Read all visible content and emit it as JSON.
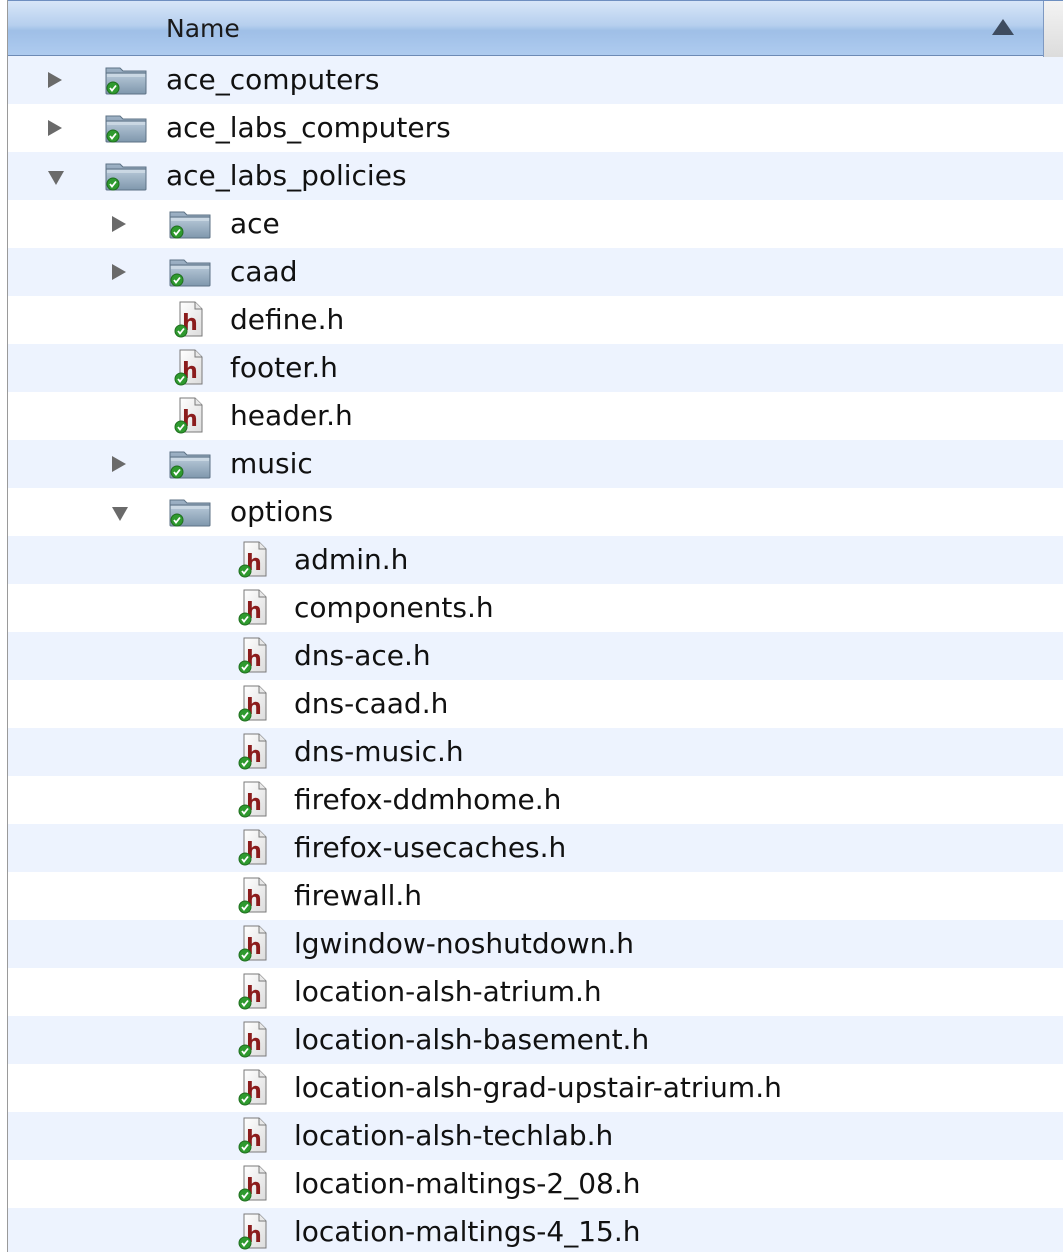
{
  "header": {
    "name_label": "Name"
  },
  "rows": [
    {
      "label": "ace_computers",
      "kind": "folder",
      "depth": 0,
      "state": "collapsed"
    },
    {
      "label": "ace_labs_computers",
      "kind": "folder",
      "depth": 0,
      "state": "collapsed"
    },
    {
      "label": "ace_labs_policies",
      "kind": "folder",
      "depth": 0,
      "state": "expanded"
    },
    {
      "label": "ace",
      "kind": "folder",
      "depth": 1,
      "state": "collapsed"
    },
    {
      "label": "caad",
      "kind": "folder",
      "depth": 1,
      "state": "collapsed"
    },
    {
      "label": "define.h",
      "kind": "file",
      "depth": 1
    },
    {
      "label": "footer.h",
      "kind": "file",
      "depth": 1
    },
    {
      "label": "header.h",
      "kind": "file",
      "depth": 1
    },
    {
      "label": "music",
      "kind": "folder",
      "depth": 1,
      "state": "collapsed"
    },
    {
      "label": "options",
      "kind": "folder",
      "depth": 1,
      "state": "expanded"
    },
    {
      "label": "admin.h",
      "kind": "file",
      "depth": 2
    },
    {
      "label": "components.h",
      "kind": "file",
      "depth": 2
    },
    {
      "label": "dns-ace.h",
      "kind": "file",
      "depth": 2
    },
    {
      "label": "dns-caad.h",
      "kind": "file",
      "depth": 2
    },
    {
      "label": "dns-music.h",
      "kind": "file",
      "depth": 2
    },
    {
      "label": "firefox-ddmhome.h",
      "kind": "file",
      "depth": 2
    },
    {
      "label": "firefox-usecaches.h",
      "kind": "file",
      "depth": 2
    },
    {
      "label": "firewall.h",
      "kind": "file",
      "depth": 2
    },
    {
      "label": "lgwindow-noshutdown.h",
      "kind": "file",
      "depth": 2
    },
    {
      "label": "location-alsh-atrium.h",
      "kind": "file",
      "depth": 2
    },
    {
      "label": "location-alsh-basement.h",
      "kind": "file",
      "depth": 2
    },
    {
      "label": "location-alsh-grad-upstair-atrium.h",
      "kind": "file",
      "depth": 2
    },
    {
      "label": "location-alsh-techlab.h",
      "kind": "file",
      "depth": 2
    },
    {
      "label": "location-maltings-2_08.h",
      "kind": "file",
      "depth": 2
    },
    {
      "label": "location-maltings-4_15.h",
      "kind": "file",
      "depth": 2
    }
  ],
  "icons": {
    "folder": "folder-icon",
    "file": "header-file-icon",
    "badge": "synced-check-badge",
    "collapsed": "disclosure-collapsed-icon",
    "expanded": "disclosure-expanded-icon",
    "sort": "sort-ascending-icon"
  },
  "colors": {
    "header_top": "#d7e6f8",
    "header_bottom": "#9fbfe7",
    "row_alt": "#edf3fe",
    "badge_green": "#2f9a2f",
    "file_letter": "#8b1c1c"
  }
}
